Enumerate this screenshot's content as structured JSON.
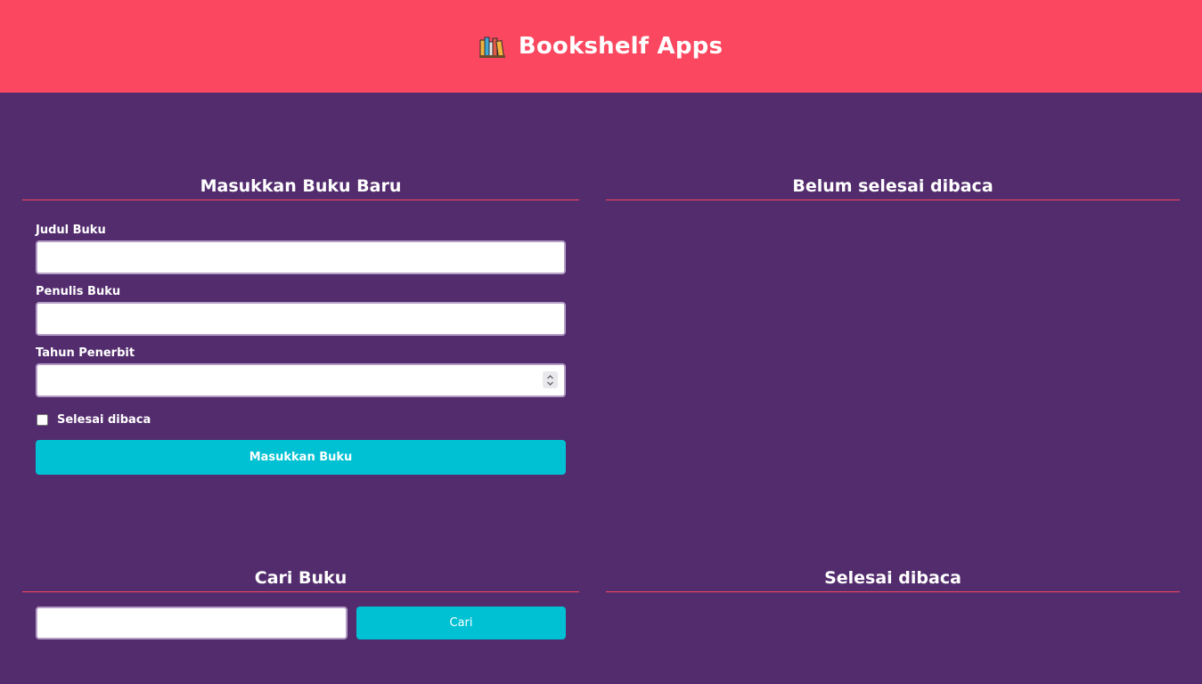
{
  "header": {
    "title": "Bookshelf Apps",
    "icon": "books-icon",
    "background_color": "#fb4860"
  },
  "input_section": {
    "title": "Masukkan Buku Baru",
    "fields": {
      "title_label": "Judul Buku",
      "title_value": "",
      "author_label": "Penulis Buku",
      "author_value": "",
      "year_label": "Tahun Penerbit",
      "year_value": ""
    },
    "completed_checkbox": {
      "label": "Selesai dibaca",
      "checked": false
    },
    "submit_label": "Masukkan Buku"
  },
  "unfinished_section": {
    "title": "Belum selesai dibaca",
    "items": []
  },
  "search_section": {
    "title": "Cari Buku",
    "query_value": "",
    "button_label": "Cari"
  },
  "finished_section": {
    "title": "Selesai dibaca",
    "items": []
  },
  "colors": {
    "background": "#532c6d",
    "accent": "#fb4860",
    "button": "#00c1d4"
  }
}
